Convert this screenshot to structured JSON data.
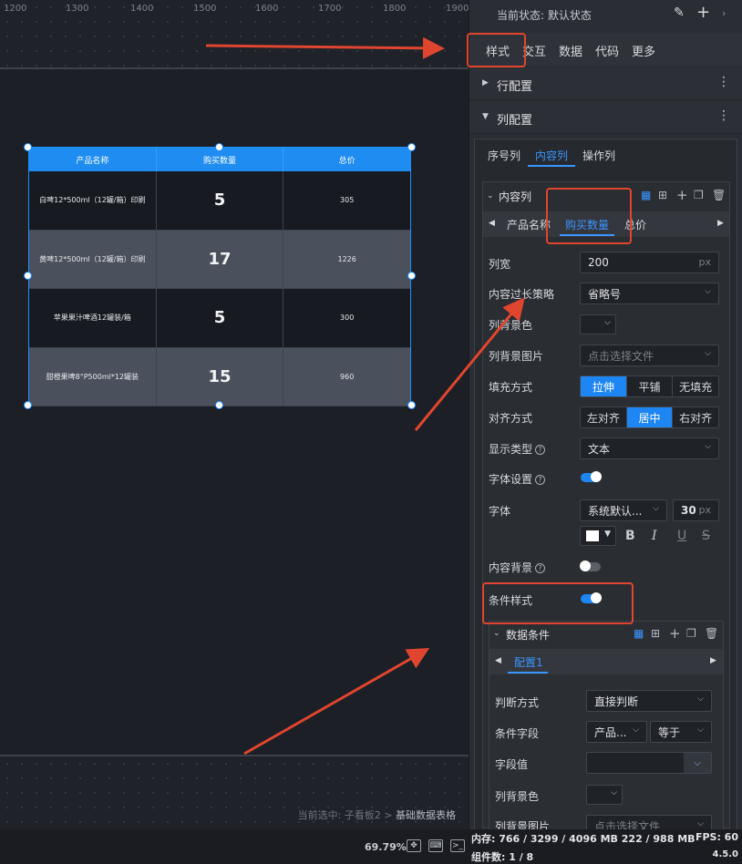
{
  "ruler": {
    "ticks": [
      "1200",
      "1300",
      "1400",
      "1500",
      "1600",
      "1700",
      "1800",
      "1900"
    ]
  },
  "canvas": {
    "breadcrumb_prefix": "当前选中: 子看板2 >",
    "breadcrumb_current": "基础数据表格"
  },
  "table": {
    "headers": [
      "产品名称",
      "购买数量",
      "总价"
    ],
    "rows": [
      {
        "name": "白啤12*500ml（12罐/箱）印刷",
        "qty": "5",
        "total": "305"
      },
      {
        "name": "黄啤12*500ml（12罐/箱）印刷",
        "qty": "17",
        "total": "1226"
      },
      {
        "name": "苹果果汁啤酒12罐装/箱",
        "qty": "5",
        "total": "300"
      },
      {
        "name": "甜橙果啤8°P500ml*12罐装",
        "qty": "15",
        "total": "960"
      }
    ]
  },
  "status": {
    "zoom": "69.79%",
    "memory": "内存:  766 / 3299 / 4096 MB  222 / 988 MB",
    "components": "组件数: 1 / 8",
    "fps": "FPS:  60",
    "version": "4.5.0"
  },
  "panel": {
    "state_label": "当前状态:  默认状态",
    "main_tabs": [
      "样式",
      "交互",
      "数据",
      "代码",
      "更多"
    ],
    "row_config": "行配置",
    "col_config": "列配置",
    "sub_tabs": [
      "序号列",
      "内容列",
      "操作列"
    ],
    "content_col": "内容列",
    "col_tabs": [
      "产品名称",
      "购买数量",
      "总价"
    ],
    "labels": {
      "width": "列宽",
      "overflow": "内容过长策略",
      "bg_color": "列背景色",
      "bg_image": "列背景图片",
      "fill": "填充方式",
      "align": "对齐方式",
      "display": "显示类型",
      "font_setting": "字体设置",
      "font": "字体",
      "content_bg": "内容背景",
      "cond_style": "条件样式"
    },
    "values": {
      "width": "200",
      "width_unit": "px",
      "overflow": "省略号",
      "bg_image_ph": "点击选择文件",
      "fill_opts": [
        "拉伸",
        "平铺",
        "无填充"
      ],
      "align_opts": [
        "左对齐",
        "居中",
        "右对齐"
      ],
      "display": "文本",
      "font": "系统默认...",
      "font_size": "30",
      "font_unit": "px"
    },
    "cond": {
      "title": "数据条件",
      "config_tab": "配置1",
      "judge_label": "判断方式",
      "judge_value": "直接判断",
      "field_label": "条件字段",
      "field_value": "产品...",
      "op_value": "等于",
      "value_label": "字段值",
      "bg_label": "列背景色",
      "bgimg_label": "列背景图片",
      "bgimg_ph": "点击选择文件"
    }
  },
  "colors": {
    "accent": "#1e86f2",
    "annotation": "#e0452f",
    "table_header": "#1e8cf0"
  }
}
